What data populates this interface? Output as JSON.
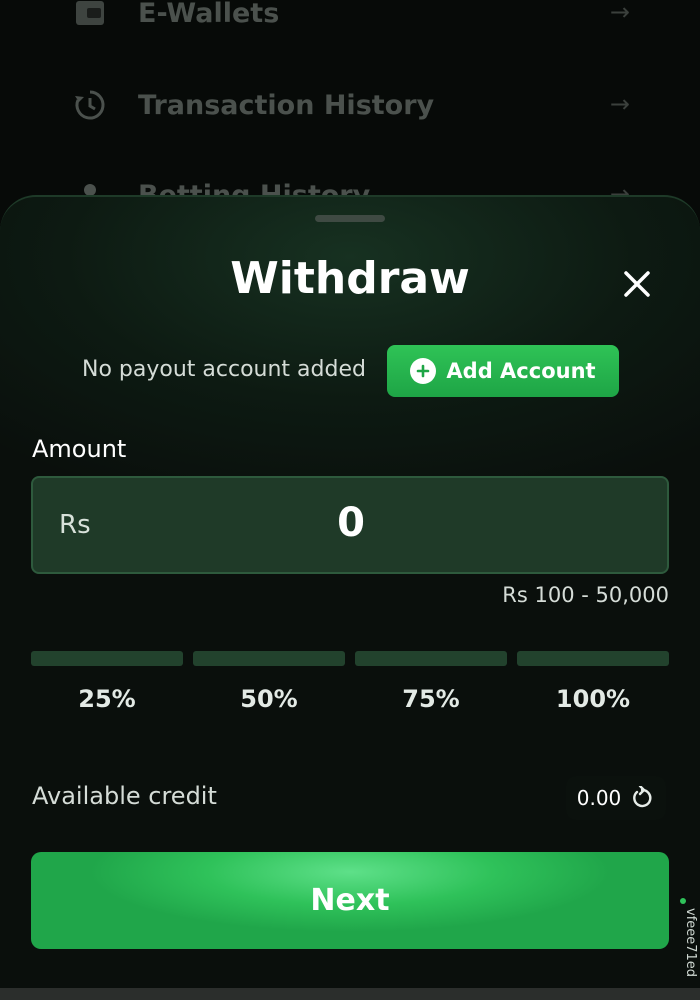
{
  "background_menu": {
    "items": [
      {
        "label": "E-Wallets",
        "icon": "wallet-icon"
      },
      {
        "label": "Transaction History",
        "icon": "history-icon"
      },
      {
        "label": "Betting History",
        "icon": "location-icon"
      }
    ]
  },
  "sheet": {
    "title": "Withdraw",
    "no_account_text": "No payout account added",
    "add_account_label": "Add Account",
    "amount_label": "Amount",
    "currency": "Rs",
    "amount_value": "0",
    "range_text": "Rs 100 - 50,000",
    "percent_options": [
      "25%",
      "50%",
      "75%",
      "100%"
    ],
    "credit_label": "Available credit",
    "credit_value": "0.00",
    "next_label": "Next"
  },
  "watermark": "vfeee71ed",
  "colors": {
    "accent_green": "#2fc25a",
    "amount_box_bg": "#1f3a28",
    "sheet_bg": "#0d1a12"
  }
}
